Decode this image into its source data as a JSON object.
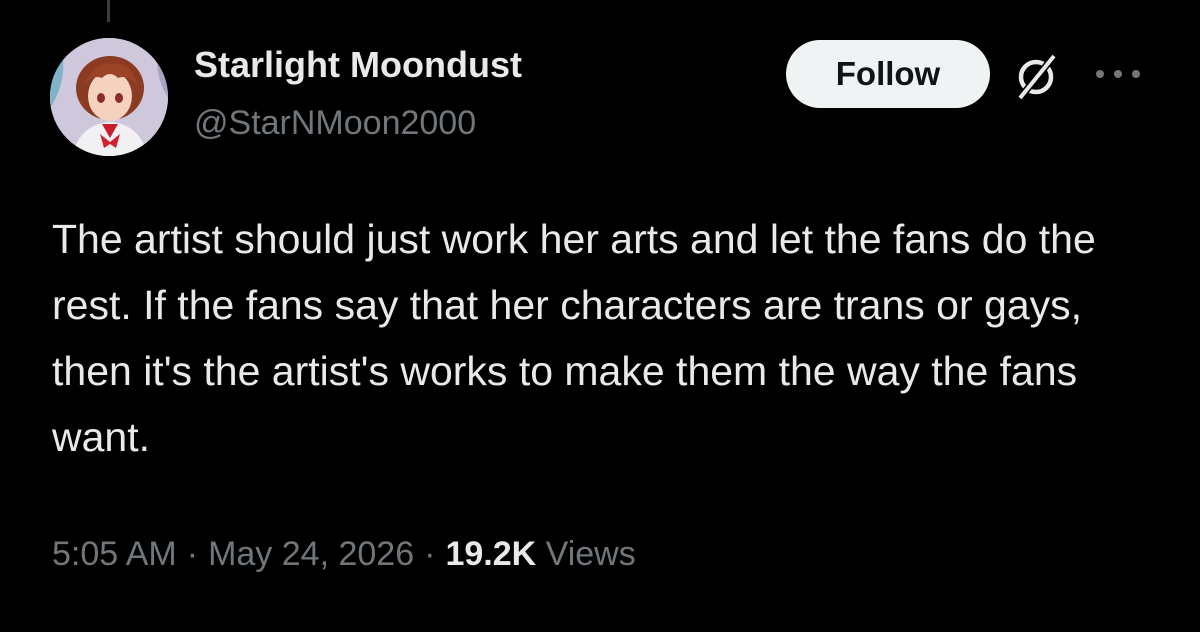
{
  "author": {
    "display_name": "Starlight Moondust",
    "handle": "@StarNMoon2000"
  },
  "actions": {
    "follow_label": "Follow",
    "grok_icon": "grok-slash-circle-icon",
    "more_icon": "more-horizontal-icon"
  },
  "tweet": {
    "text": "The artist should just work her arts and let the fans do the rest. If the fans say that her characters are trans or gays, then it's the artist's works to make them the way the fans want."
  },
  "meta": {
    "time": "5:05 AM",
    "separator": "·",
    "date": "May 24, 2026",
    "views_count": "19.2K",
    "views_label": "Views"
  },
  "colors": {
    "background": "#000000",
    "primary_text": "#e7e9ea",
    "secondary_text": "#71767b",
    "follow_button_bg": "#eff3f4",
    "follow_button_text": "#0f1419"
  }
}
